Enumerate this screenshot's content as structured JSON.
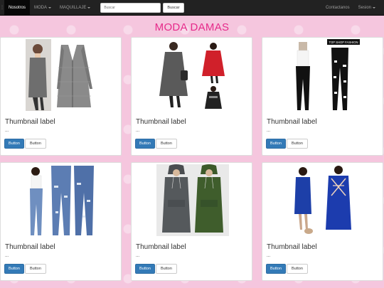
{
  "navbar": {
    "brand_glyph": "⋮",
    "items": [
      {
        "label": "Nosotros",
        "active": true,
        "dropdown": false
      },
      {
        "label": "MODA",
        "active": false,
        "dropdown": true
      },
      {
        "label": "MAQUILLAJE",
        "active": false,
        "dropdown": true
      }
    ],
    "search_placeholder": "Buscar",
    "search_button": "Buscar",
    "right_items": [
      {
        "label": "Contactanos",
        "dropdown": false
      },
      {
        "label": "Sesion",
        "dropdown": true
      }
    ]
  },
  "page_title": "MODA DAMAS",
  "cards": [
    {
      "label": "Thumbnail label",
      "description": "...",
      "primary_button": "Button",
      "secondary_button": "Button",
      "image": "grey-plaid-coat"
    },
    {
      "label": "Thumbnail label",
      "description": "...",
      "primary_button": "Button",
      "secondary_button": "Button",
      "image": "grey-and-red-coats"
    },
    {
      "label": "Thumbnail label",
      "description": "...",
      "primary_button": "Button",
      "secondary_button": "Button",
      "image": "ripped-black-jeans",
      "image_caption": "TOP SHOP FASHION"
    },
    {
      "label": "Thumbnail label",
      "description": "...",
      "primary_button": "Button",
      "secondary_button": "Button",
      "image": "blue-ripped-jeans"
    },
    {
      "label": "Thumbnail label",
      "description": "...",
      "primary_button": "Button",
      "secondary_button": "Button",
      "image": "hooded-dresses"
    },
    {
      "label": "Thumbnail label",
      "description": "...",
      "primary_button": "Button",
      "secondary_button": "Button",
      "image": "blue-bodycon-dress"
    }
  ],
  "colors": {
    "background": "#f5c6de",
    "title": "#e62a8a",
    "navbar": "#222222",
    "primary": "#337ab7"
  }
}
